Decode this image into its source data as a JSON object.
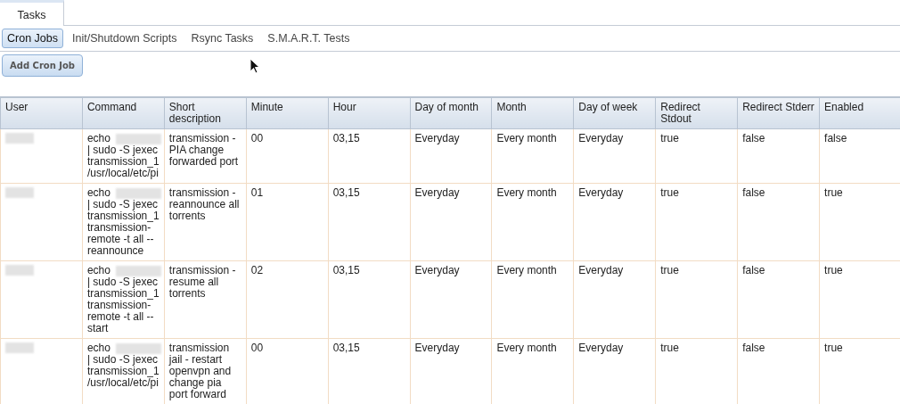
{
  "tabs": [
    {
      "label": "Tasks",
      "selected": true
    }
  ],
  "subtabs": [
    {
      "label": "Cron Jobs",
      "selected": true
    },
    {
      "label": "Init/Shutdown Scripts",
      "selected": false
    },
    {
      "label": "Rsync Tasks",
      "selected": false
    },
    {
      "label": "S.M.A.R.T. Tests",
      "selected": false
    }
  ],
  "add_button": "Add Cron Job",
  "table": {
    "columns": [
      "User",
      "Command",
      "Short\ndescription",
      "Minute",
      "Hour",
      "Day of month",
      "Month",
      "Day of week",
      "Redirect\nStdout",
      "Redirect Stderr",
      "Enabled"
    ],
    "rows": [
      {
        "cells": [
          {
            "kind": "redacted"
          },
          {
            "kind": "command",
            "prefix": "echo",
            "rest": "| sudo -S jexec\ntransmission_1\n/usr/local/etc/pi"
          },
          {
            "kind": "text",
            "text": "transmission -\nPIA change\nforwarded port"
          },
          {
            "kind": "text",
            "text": "00"
          },
          {
            "kind": "text",
            "text": "03,15"
          },
          {
            "kind": "text",
            "text": "Everyday"
          },
          {
            "kind": "text",
            "text": "Every month"
          },
          {
            "kind": "text",
            "text": "Everyday"
          },
          {
            "kind": "text",
            "text": "true"
          },
          {
            "kind": "text",
            "text": "false"
          },
          {
            "kind": "text",
            "text": "false"
          }
        ]
      },
      {
        "cells": [
          {
            "kind": "redacted"
          },
          {
            "kind": "command",
            "prefix": "echo",
            "rest": "| sudo -S jexec\ntransmission_1\ntransmission-\nremote -t all --\nreannounce"
          },
          {
            "kind": "text",
            "text": "transmission -\nreannounce all\ntorrents"
          },
          {
            "kind": "text",
            "text": "01"
          },
          {
            "kind": "text",
            "text": "03,15"
          },
          {
            "kind": "text",
            "text": "Everyday"
          },
          {
            "kind": "text",
            "text": "Every month"
          },
          {
            "kind": "text",
            "text": "Everyday"
          },
          {
            "kind": "text",
            "text": "true"
          },
          {
            "kind": "text",
            "text": "false"
          },
          {
            "kind": "text",
            "text": "true"
          }
        ]
      },
      {
        "cells": [
          {
            "kind": "redacted"
          },
          {
            "kind": "command",
            "prefix": "echo",
            "rest": "| sudo -S jexec\ntransmission_1\ntransmission-\nremote -t all --\nstart"
          },
          {
            "kind": "text",
            "text": "transmission -\nresume all\ntorrents"
          },
          {
            "kind": "text",
            "text": "02"
          },
          {
            "kind": "text",
            "text": "03,15"
          },
          {
            "kind": "text",
            "text": "Everyday"
          },
          {
            "kind": "text",
            "text": "Every month"
          },
          {
            "kind": "text",
            "text": "Everyday"
          },
          {
            "kind": "text",
            "text": "true"
          },
          {
            "kind": "text",
            "text": "false"
          },
          {
            "kind": "text",
            "text": "true"
          }
        ]
      },
      {
        "cells": [
          {
            "kind": "redacted"
          },
          {
            "kind": "command",
            "prefix": "echo",
            "rest": "| sudo -S jexec\ntransmission_1\n/usr/local/etc/pi"
          },
          {
            "kind": "text",
            "text": "transmission\njail - restart\nopenvpn and\nchange pia\nport forward"
          },
          {
            "kind": "text",
            "text": "00"
          },
          {
            "kind": "text",
            "text": "03,15"
          },
          {
            "kind": "text",
            "text": "Everyday"
          },
          {
            "kind": "text",
            "text": "Every month"
          },
          {
            "kind": "text",
            "text": "Everyday"
          },
          {
            "kind": "text",
            "text": "true"
          },
          {
            "kind": "text",
            "text": "false"
          },
          {
            "kind": "text",
            "text": "true"
          }
        ]
      }
    ]
  }
}
